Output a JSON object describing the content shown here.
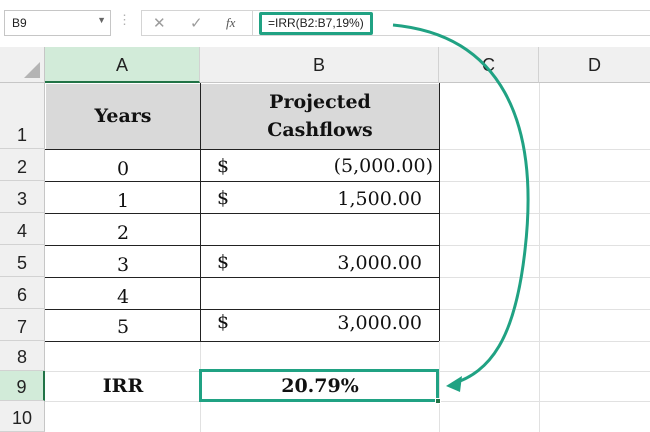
{
  "name_box": {
    "value": "B9"
  },
  "formula_bar": {
    "cancel_icon": "✕",
    "enter_icon": "✓",
    "fx_label": "fx",
    "formula": "=IRR(B2:B7,19%)"
  },
  "columns": [
    "A",
    "B",
    "C",
    "D"
  ],
  "rows": [
    "1",
    "2",
    "3",
    "4",
    "5",
    "6",
    "7",
    "8",
    "9",
    "10"
  ],
  "table": {
    "header_years": "Years",
    "header_cashflows_line1": "Projected",
    "header_cashflows_line2": "Cashflows",
    "years": [
      "0",
      "1",
      "2",
      "3",
      "4",
      "5"
    ],
    "currency_symbol": "$",
    "cashflows": [
      "(5,000.00)",
      "1,500.00",
      "",
      "3,000.00",
      "",
      "3,000.00"
    ],
    "irr_label": "IRR",
    "irr_value": "20.79%"
  },
  "colors": {
    "highlight": "#20a283",
    "header_fill": "#d9d9d9",
    "selected_header": "#d2ebd9"
  }
}
